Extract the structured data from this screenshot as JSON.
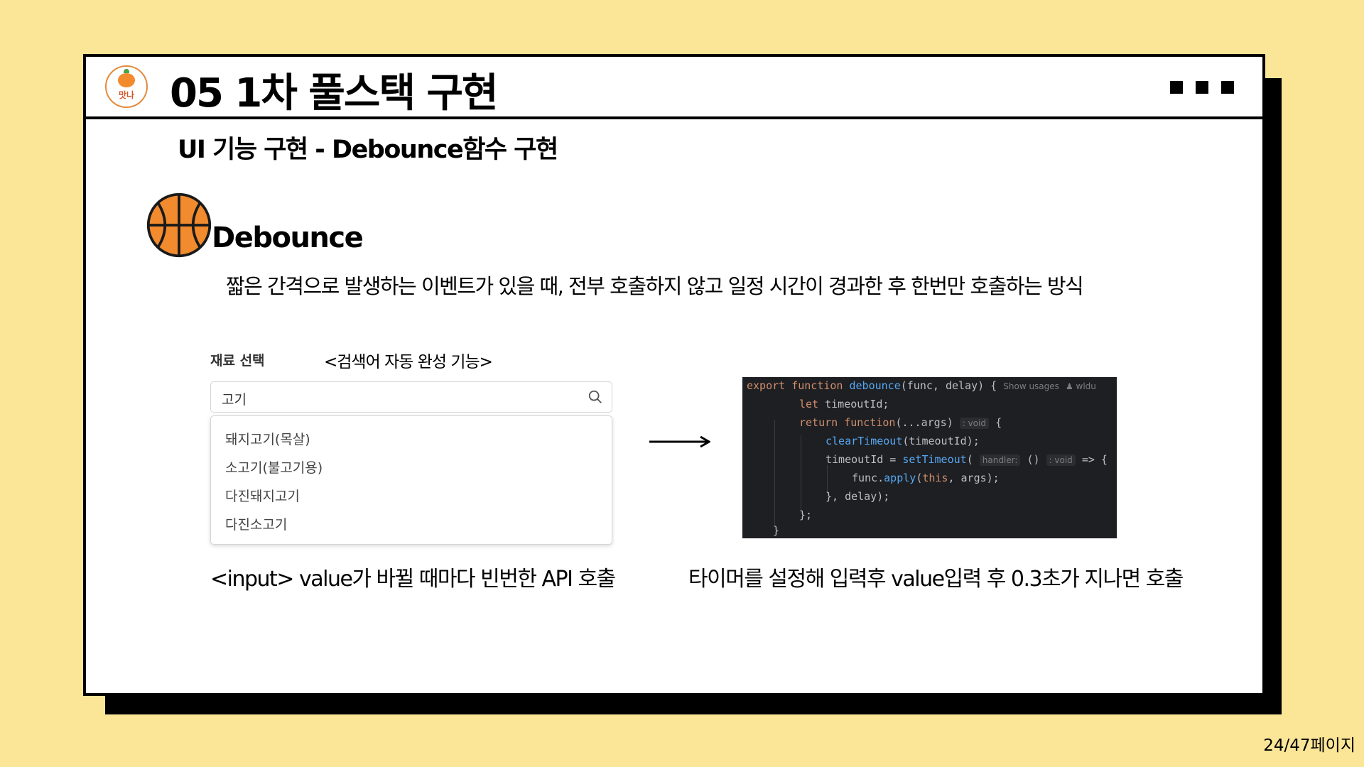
{
  "header": {
    "logo_text": "맛나",
    "title": "05  1차 풀스택 구현"
  },
  "subtitle": "UI 기능 구현 - Debounce함수 구현",
  "section": {
    "title": "Debounce",
    "description": "짧은 간격으로 발생하는 이벤트가 있을 때, 전부 호출하지 않고 일정 시간이 경과한 후 한번만 호출하는 방식"
  },
  "demo": {
    "label": "재료 선택",
    "caption": "<검색어 자동 완성 기능>",
    "search_value": "고기",
    "suggestions": [
      "돼지고기(목살)",
      "소고기(불고기용)",
      "다진돼지고기",
      "다진소고기"
    ]
  },
  "code": {
    "show_usages": "Show usages",
    "author": "wldu",
    "void_hint": ": void",
    "handler_hint": "handler:"
  },
  "captions": {
    "left": "<input> value가 바뀔 때마다 빈번한 API 호출",
    "right": "타이머를 설정해 입력후 value입력 후 0.3초가 지나면 호출"
  },
  "page_number": "24/47페이지",
  "colors": {
    "background": "#fbe597",
    "code_bg": "#1e1f22",
    "ball": "#f28a2e"
  }
}
